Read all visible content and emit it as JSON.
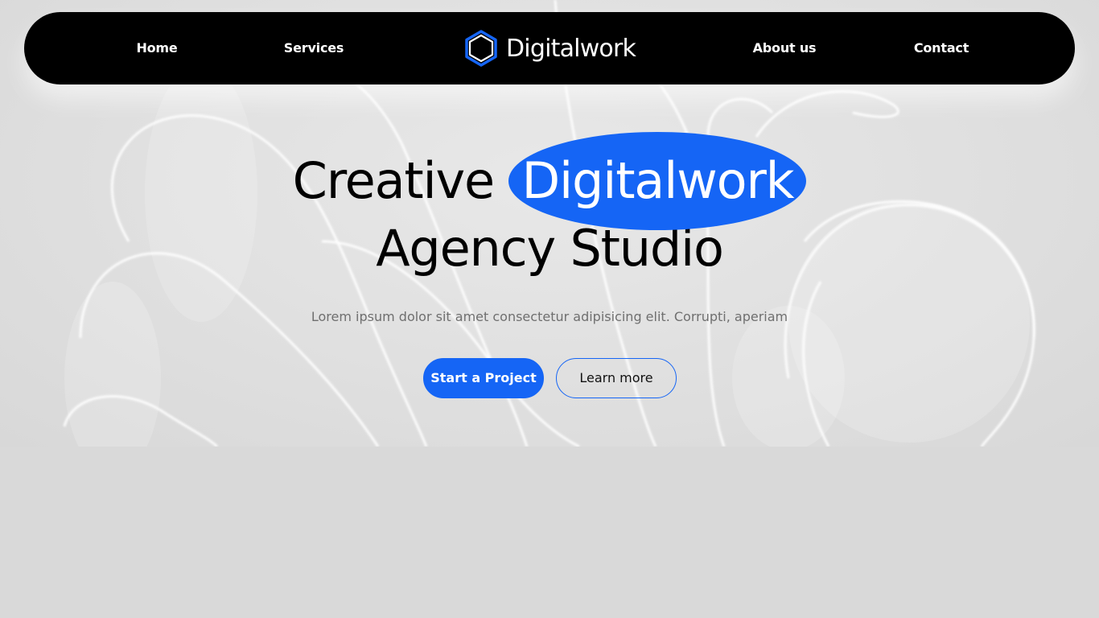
{
  "nav": {
    "links": [
      {
        "label": "Home"
      },
      {
        "label": "Services"
      },
      {
        "label": "About us"
      },
      {
        "label": "Contact"
      }
    ],
    "brand": {
      "name": "Digitalwork",
      "logo_icon": "hexagon-icon"
    }
  },
  "hero": {
    "headline_part1": "Creative",
    "headline_highlight": "Digitalwork",
    "headline_line2": "Agency Studio",
    "subtitle": "Lorem ipsum dolor sit amet consectetur adipisicing elit. Corrupti, aperiam",
    "primary_button": "Start a Project",
    "secondary_button": "Learn more"
  },
  "colors": {
    "accent": "#1565f5",
    "nav_background": "#000000",
    "page_background": "#d9d9d9"
  }
}
